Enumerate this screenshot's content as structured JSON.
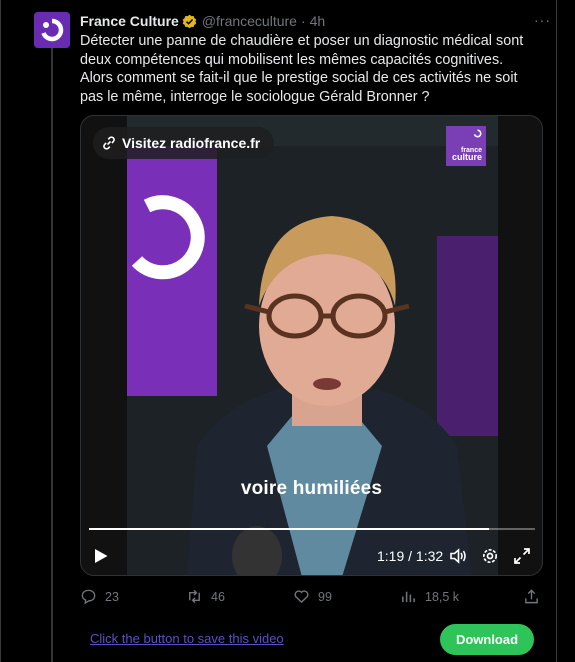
{
  "tweet": {
    "display_name": "France Culture",
    "handle": "@franceculture",
    "separator": "·",
    "time": "4h",
    "more_label": "···",
    "text": "Détecter une panne de chaudière et poser un diagnostic médical sont deux compétences qui mobilisent les mêmes capacités cognitives. Alors comment se fait-il que le prestige social de ces activités ne soit pas le même, interroge le sociologue Gérald Bronner ?",
    "verified_icon": "verified-badge-icon",
    "avatar_icon": "france-culture-logo"
  },
  "video": {
    "link_label": "Visitez radiofrance.fr",
    "brand_line1": "france",
    "brand_line2": "culture",
    "subtitle": "voire humiliées",
    "progress": 0.896,
    "timecode": "1:19 / 1:32",
    "controls": [
      "play-icon",
      "volume-icon",
      "settings-icon",
      "fullscreen-icon"
    ]
  },
  "actions": {
    "replies": "23",
    "reposts": "46",
    "likes": "99",
    "views": "18,5 k"
  },
  "footer": {
    "save_link": "Click the button to save this video",
    "download_label": "Download"
  },
  "colors": {
    "background": "#000000",
    "accent_purple": "#6a2bb3",
    "download_green": "#2fc45a",
    "link_purple": "#5b4fc6",
    "muted_text": "#71767b"
  }
}
